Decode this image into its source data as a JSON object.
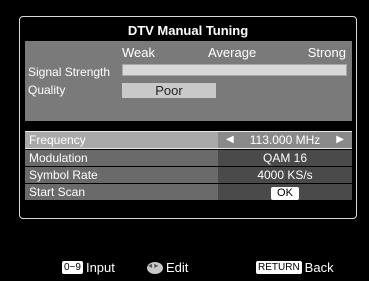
{
  "title": "DTV Manual Tuning",
  "signal": {
    "level_labels": [
      "Weak",
      "Average",
      "Strong"
    ],
    "strength_label": "Signal Strength",
    "strength_fraction": 0.0,
    "quality_label": "Quality",
    "quality_value": "Poor"
  },
  "settings": {
    "frequency": {
      "label": "Frequency",
      "value": "113.000 MHz"
    },
    "modulation": {
      "label": "Modulation",
      "value": "QAM 16"
    },
    "symbol_rate": {
      "label": "Symbol Rate",
      "value": "4000 KS/s"
    },
    "start_scan": {
      "label": "Start Scan",
      "button": "OK"
    }
  },
  "footer": {
    "input_key": "0~9",
    "input_label": "Input",
    "edit_label": "Edit",
    "back_key": "RETURN",
    "back_label": "Back"
  }
}
